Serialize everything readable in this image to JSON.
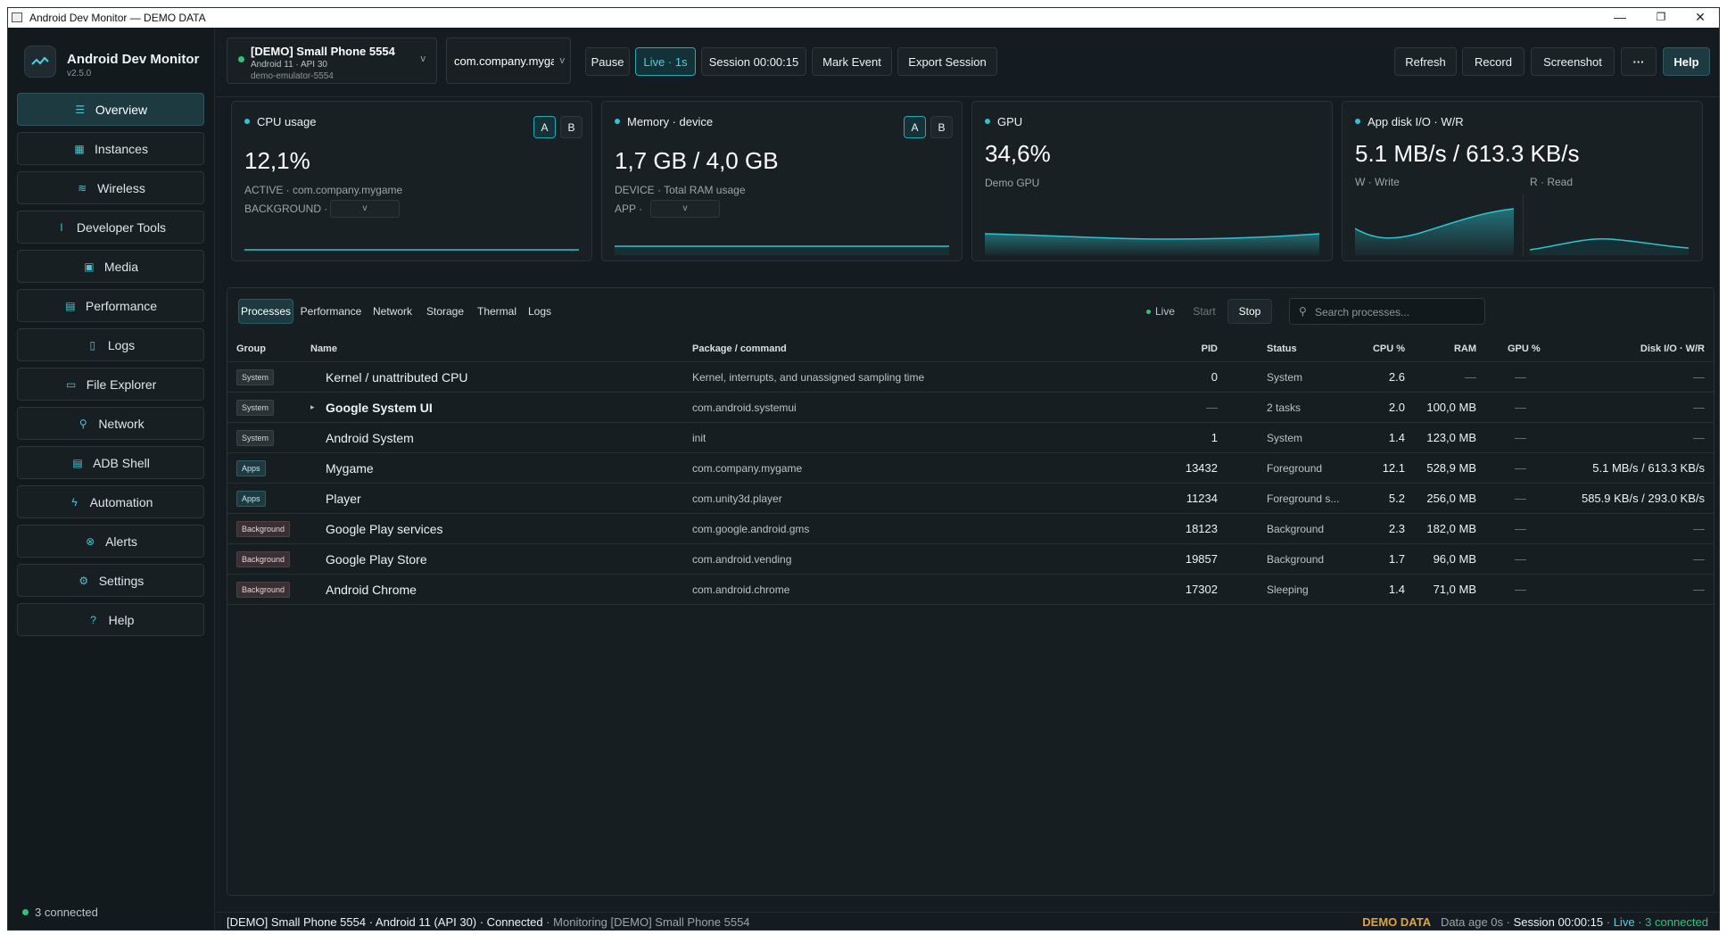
{
  "window": {
    "title": "Android Dev Monitor — DEMO DATA",
    "min": "—",
    "max": "❐",
    "close": "✕"
  },
  "app": {
    "name": "Android Dev Monitor",
    "version": "v2.5.0"
  },
  "nav": [
    {
      "label": "Overview",
      "icon": "overview-icon",
      "glyph": "☰"
    },
    {
      "label": "Instances",
      "icon": "grid-icon",
      "glyph": "▦"
    },
    {
      "label": "Wireless",
      "icon": "wifi-icon",
      "glyph": "≋"
    },
    {
      "label": "Developer Tools",
      "icon": "thermometer-icon",
      "glyph": "ǀ"
    },
    {
      "label": "Media",
      "icon": "image-icon",
      "glyph": "▣"
    },
    {
      "label": "Performance",
      "icon": "chart-icon",
      "glyph": "▤"
    },
    {
      "label": "Logs",
      "icon": "file-icon",
      "glyph": "▯"
    },
    {
      "label": "File Explorer",
      "icon": "folder-icon",
      "glyph": "▭"
    },
    {
      "label": "Network",
      "icon": "network-icon",
      "glyph": "⚲"
    },
    {
      "label": "ADB Shell",
      "icon": "terminal-icon",
      "glyph": "▤"
    },
    {
      "label": "Automation",
      "icon": "bolt-icon",
      "glyph": "ϟ"
    },
    {
      "label": "Alerts",
      "icon": "alert-icon",
      "glyph": "⊗"
    },
    {
      "label": "Settings",
      "icon": "gear-icon",
      "glyph": "⚙"
    },
    {
      "label": "Help",
      "icon": "help-icon",
      "glyph": "?"
    }
  ],
  "sidebar_footer": {
    "connected": "3 connected"
  },
  "device": {
    "name": "[DEMO] Small Phone 5554",
    "os": "Android 11 · API 30",
    "serial": "demo-emulator-5554",
    "chev": "v"
  },
  "package": {
    "value": "com.company.mygame",
    "chev": "v"
  },
  "toolbar": {
    "pause": "Pause",
    "live": "Live · 1s",
    "session": "Session 00:00:15",
    "mark": "Mark Event",
    "export": "Export Session",
    "refresh": "Refresh",
    "record": "Record",
    "screenshot": "Screenshot",
    "more": "···",
    "help": "Help"
  },
  "cards": {
    "cpu": {
      "title": "CPU usage",
      "value": "12,1%",
      "line1": "ACTIVE · com.company.mygame",
      "line2": "BACKGROUND ·",
      "a": "A",
      "b": "B",
      "chev": "v"
    },
    "mem": {
      "title": "Memory · device",
      "value": "1,7 GB / 4,0 GB",
      "line1": "DEVICE · Total RAM usage",
      "line2": "APP ·",
      "a": "A",
      "b": "B",
      "chev": "v"
    },
    "gpu": {
      "title": "GPU",
      "value": "34,6%",
      "line1": "Demo GPU"
    },
    "disk": {
      "title": "App disk I/O · W/R",
      "value": "5.1 MB/s / 613.3 KB/s",
      "write": "W · Write",
      "read": "R · Read"
    }
  },
  "tabs": [
    "Processes",
    "Performance",
    "Network",
    "Storage",
    "Thermal",
    "Logs"
  ],
  "proc_ctl": {
    "live": "Live",
    "start": "Start",
    "stop": "Stop"
  },
  "search": {
    "placeholder": "Search processes...",
    "icon": "⚲"
  },
  "table": {
    "headers": {
      "group": "Group",
      "name": "Name",
      "pkg": "Package / command",
      "pid": "PID",
      "status": "Status",
      "cpu": "CPU %",
      "ram": "RAM",
      "gpu": "GPU %",
      "disk": "Disk I/O · W/R"
    },
    "rows": [
      {
        "group": "System",
        "kind": "sys",
        "name": "Kernel / unattributed CPU",
        "bold": false,
        "expander": "",
        "pkg": "Kernel, interrupts, and unassigned sampling time",
        "pid": "0",
        "status": "System",
        "cpu": "2.6",
        "ram": "—",
        "gpu": "—",
        "disk": "—"
      },
      {
        "group": "System",
        "kind": "sys",
        "name": "Google System UI",
        "bold": true,
        "expander": "▸",
        "pkg": "com.android.systemui",
        "pid": "—",
        "status": "2 tasks",
        "cpu": "2.0",
        "ram": "100,0 MB",
        "gpu": "—",
        "disk": "—"
      },
      {
        "group": "System",
        "kind": "sys",
        "name": "Android System",
        "bold": false,
        "expander": "",
        "pkg": "init",
        "pid": "1",
        "status": "System",
        "cpu": "1.4",
        "ram": "123,0 MB",
        "gpu": "—",
        "disk": "—"
      },
      {
        "group": "Apps",
        "kind": "apps",
        "name": "Mygame",
        "bold": false,
        "expander": "",
        "pkg": "com.company.mygame",
        "pid": "13432",
        "status": "Foreground",
        "cpu": "12.1",
        "ram": "528,9 MB",
        "gpu": "—",
        "disk": "5.1 MB/s / 613.3 KB/s"
      },
      {
        "group": "Apps",
        "kind": "apps",
        "name": "Player",
        "bold": false,
        "expander": "",
        "pkg": "com.unity3d.player",
        "pid": "11234",
        "status": "Foreground s...",
        "cpu": "5.2",
        "ram": "256,0 MB",
        "gpu": "—",
        "disk": "585.9 KB/s / 293.0 KB/s"
      },
      {
        "group": "Background",
        "kind": "bg",
        "name": "Google Play services",
        "bold": false,
        "expander": "",
        "pkg": "com.google.android.gms",
        "pid": "18123",
        "status": "Background",
        "cpu": "2.3",
        "ram": "182,0 MB",
        "gpu": "—",
        "disk": "—"
      },
      {
        "group": "Background",
        "kind": "bg",
        "name": "Google Play Store",
        "bold": false,
        "expander": "",
        "pkg": "com.android.vending",
        "pid": "19857",
        "status": "Background",
        "cpu": "1.7",
        "ram": "96,0 MB",
        "gpu": "—",
        "disk": "—"
      },
      {
        "group": "Background",
        "kind": "bg",
        "name": "Android Chrome",
        "bold": false,
        "expander": "",
        "pkg": "com.android.chrome",
        "pid": "17302",
        "status": "Sleeping",
        "cpu": "1.4",
        "ram": "71,0 MB",
        "gpu": "—",
        "disk": "—"
      }
    ]
  },
  "status": {
    "left": "[DEMO] Small Phone 5554 · Android 11 (API 30) · Connected",
    "monitoring": "Monitoring [DEMO] Small Phone 5554",
    "sep": "·",
    "demo": "DEMO DATA",
    "age": "Data age 0s",
    "session": "Session 00:00:15",
    "live": "Live",
    "connected": "3 connected"
  },
  "colors": {
    "accent": "#2ec3cf",
    "background": "#151c21",
    "demo": "#e0a43c",
    "ok": "#28c67a"
  }
}
